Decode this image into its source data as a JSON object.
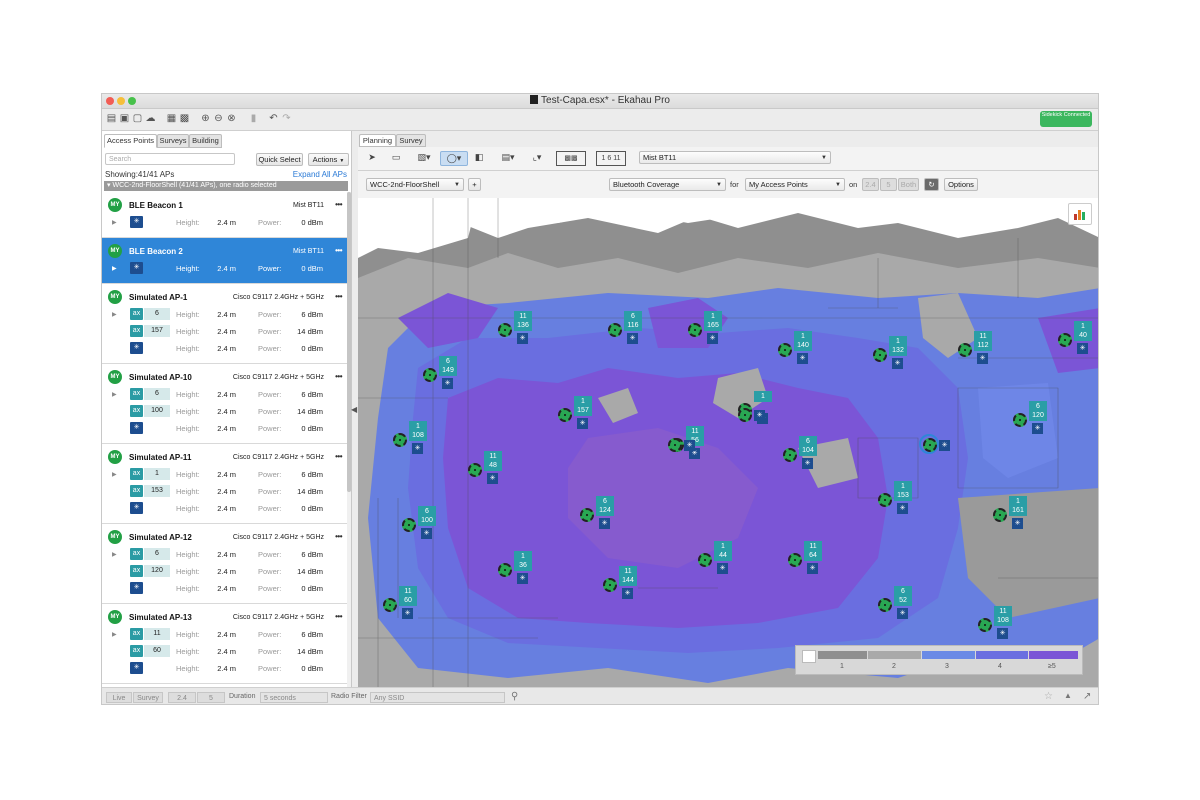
{
  "window": {
    "title": "Test-Capa.esx* - Ekahau Pro",
    "sidekick": "Sidekick Connected"
  },
  "left_panel": {
    "tabs": [
      "Access Points",
      "Surveys",
      "Building"
    ],
    "search_placeholder": "Search",
    "quick_select": "Quick Select",
    "actions": "Actions",
    "showing": "Showing:41/41 APs",
    "expand_all": "Expand All APs",
    "group": "▾ WCC-2nd-FloorShell (41/41 APs), one radio selected",
    "labels": {
      "height": "Height:",
      "power": "Power:"
    },
    "aps": [
      {
        "badge": "MY",
        "name": "BLE Beacon 1",
        "model": "Mist BT11",
        "more": "•••",
        "radios": [
          {
            "type": "bt",
            "icon": "✳",
            "channel": "",
            "height": "2.4  m",
            "power": "0  dBm"
          }
        ]
      },
      {
        "badge": "MY",
        "name": "BLE Beacon 2",
        "model": "Mist BT11",
        "more": "•••",
        "selected": true,
        "radios": [
          {
            "type": "bt",
            "icon": "✳",
            "channel": "",
            "height": "2.4  m",
            "power": "0  dBm"
          }
        ]
      },
      {
        "badge": "MY",
        "name": "Simulated AP-1",
        "model": "Cisco C9117 2.4GHz + 5GHz",
        "more": "•••",
        "radios": [
          {
            "type": "ax",
            "icon": "ax",
            "channel": "6",
            "height": "2.4  m",
            "power": "6  dBm"
          },
          {
            "type": "ax",
            "icon": "ax",
            "channel": "157",
            "height": "2.4  m",
            "power": "14  dBm"
          },
          {
            "type": "bt",
            "icon": "✳",
            "channel": "",
            "height": "2.4  m",
            "power": "0  dBm"
          }
        ]
      },
      {
        "badge": "MY",
        "name": "Simulated AP-10",
        "model": "Cisco C9117 2.4GHz + 5GHz",
        "more": "•••",
        "radios": [
          {
            "type": "ax",
            "icon": "ax",
            "channel": "6",
            "height": "2.4  m",
            "power": "6  dBm"
          },
          {
            "type": "ax",
            "icon": "ax",
            "channel": "100",
            "height": "2.4  m",
            "power": "14  dBm"
          },
          {
            "type": "bt",
            "icon": "✳",
            "channel": "",
            "height": "2.4  m",
            "power": "0  dBm"
          }
        ]
      },
      {
        "badge": "MY",
        "name": "Simulated AP-11",
        "model": "Cisco C9117 2.4GHz + 5GHz",
        "more": "•••",
        "radios": [
          {
            "type": "ax",
            "icon": "ax",
            "channel": "1",
            "height": "2.4  m",
            "power": "6  dBm"
          },
          {
            "type": "ax",
            "icon": "ax",
            "channel": "153",
            "height": "2.4  m",
            "power": "14  dBm"
          },
          {
            "type": "bt",
            "icon": "✳",
            "channel": "",
            "height": "2.4  m",
            "power": "0  dBm"
          }
        ]
      },
      {
        "badge": "MY",
        "name": "Simulated AP-12",
        "model": "Cisco C9117 2.4GHz + 5GHz",
        "more": "•••",
        "radios": [
          {
            "type": "ax",
            "icon": "ax",
            "channel": "6",
            "height": "2.4  m",
            "power": "6  dBm"
          },
          {
            "type": "ax",
            "icon": "ax",
            "channel": "120",
            "height": "2.4  m",
            "power": "14  dBm"
          },
          {
            "type": "bt",
            "icon": "✳",
            "channel": "",
            "height": "2.4  m",
            "power": "0  dBm"
          }
        ]
      },
      {
        "badge": "MY",
        "name": "Simulated AP-13",
        "model": "Cisco C9117 2.4GHz + 5GHz",
        "more": "•••",
        "radios": [
          {
            "type": "ax",
            "icon": "ax",
            "channel": "11",
            "height": "2.4  m",
            "power": "6  dBm"
          },
          {
            "type": "ax",
            "icon": "ax",
            "channel": "60",
            "height": "2.4  m",
            "power": "14  dBm"
          },
          {
            "type": "bt",
            "icon": "✳",
            "channel": "",
            "height": "2.4  m",
            "power": "0  dBm"
          }
        ]
      }
    ]
  },
  "right_panel": {
    "tabs": [
      "Planning",
      "Survey"
    ],
    "ap_model": "Mist BT11",
    "floor": "WCC-2nd-FloorShell",
    "floor_add": "+",
    "visualization": "Bluetooth Coverage",
    "for_label": "for",
    "for_value": "My Access Points",
    "on_label": "on",
    "bands": [
      "2.4",
      "5",
      "Both"
    ],
    "options": "Options",
    "legend": {
      "labels": [
        "1",
        "2",
        "3",
        "4",
        "≥5"
      ]
    },
    "markers": [
      {
        "ch": "11",
        "sub": "136",
        "bt": true
      },
      {
        "ch": "6",
        "sub": "116",
        "bt": true
      },
      {
        "ch": "1",
        "sub": "165",
        "bt": true
      },
      {
        "ch": "1",
        "sub": "140",
        "bt": true
      },
      {
        "ch": "1",
        "sub": "132",
        "bt": true
      },
      {
        "ch": "11",
        "sub": "112",
        "bt": true
      },
      {
        "ch": "1",
        "sub": "40",
        "bt": true
      },
      {
        "ch": "6",
        "sub": "149",
        "bt": true
      },
      {
        "ch": "1",
        "sub": "",
        "bt": true
      },
      {
        "ch": "",
        "sub": "",
        "bt": true
      },
      {
        "ch": "1",
        "sub": "157",
        "bt": true
      },
      {
        "ch": "1",
        "sub": "108",
        "bt": true
      },
      {
        "ch": "11",
        "sub": "56",
        "bt": true
      },
      {
        "ch": "",
        "sub": "",
        "bt": true
      },
      {
        "ch": "6",
        "sub": "104",
        "bt": true
      },
      {
        "ch": "",
        "sub": "",
        "bt": true,
        "selected": true
      },
      {
        "ch": "6",
        "sub": "120",
        "bt": true
      },
      {
        "ch": "11",
        "sub": "48",
        "bt": true
      },
      {
        "ch": "1",
        "sub": "153",
        "bt": true
      },
      {
        "ch": "6",
        "sub": "124",
        "bt": true
      },
      {
        "ch": "1",
        "sub": "161",
        "bt": true
      },
      {
        "ch": "6",
        "sub": "100",
        "bt": true
      },
      {
        "ch": "1",
        "sub": "36",
        "bt": true
      },
      {
        "ch": "1",
        "sub": "44",
        "bt": true
      },
      {
        "ch": "11",
        "sub": "64",
        "bt": true
      },
      {
        "ch": "11",
        "sub": "60",
        "bt": true
      },
      {
        "ch": "11",
        "sub": "144",
        "bt": true
      },
      {
        "ch": "6",
        "sub": "52",
        "bt": true
      },
      {
        "ch": "11",
        "sub": "108",
        "bt": true
      }
    ]
  },
  "status_bar": {
    "live": "Live",
    "survey": "Survey",
    "band_24": "2.4",
    "band_5": "5",
    "duration_label": "Duration",
    "duration_value": "5 seconds",
    "radio_filter_label": "Radio Filter",
    "radio_filter_value": "Any SSID"
  },
  "colors": {
    "selected_row": "#2f86d8",
    "heatmap_strong": "#7b55d6",
    "heatmap_mid": "#6a6ee0",
    "heatmap_weak": "#5f7ae6",
    "ap_badge": "#22a045",
    "channel_chip": "#2a9ea6",
    "bt_chip": "#1d4d8f"
  }
}
